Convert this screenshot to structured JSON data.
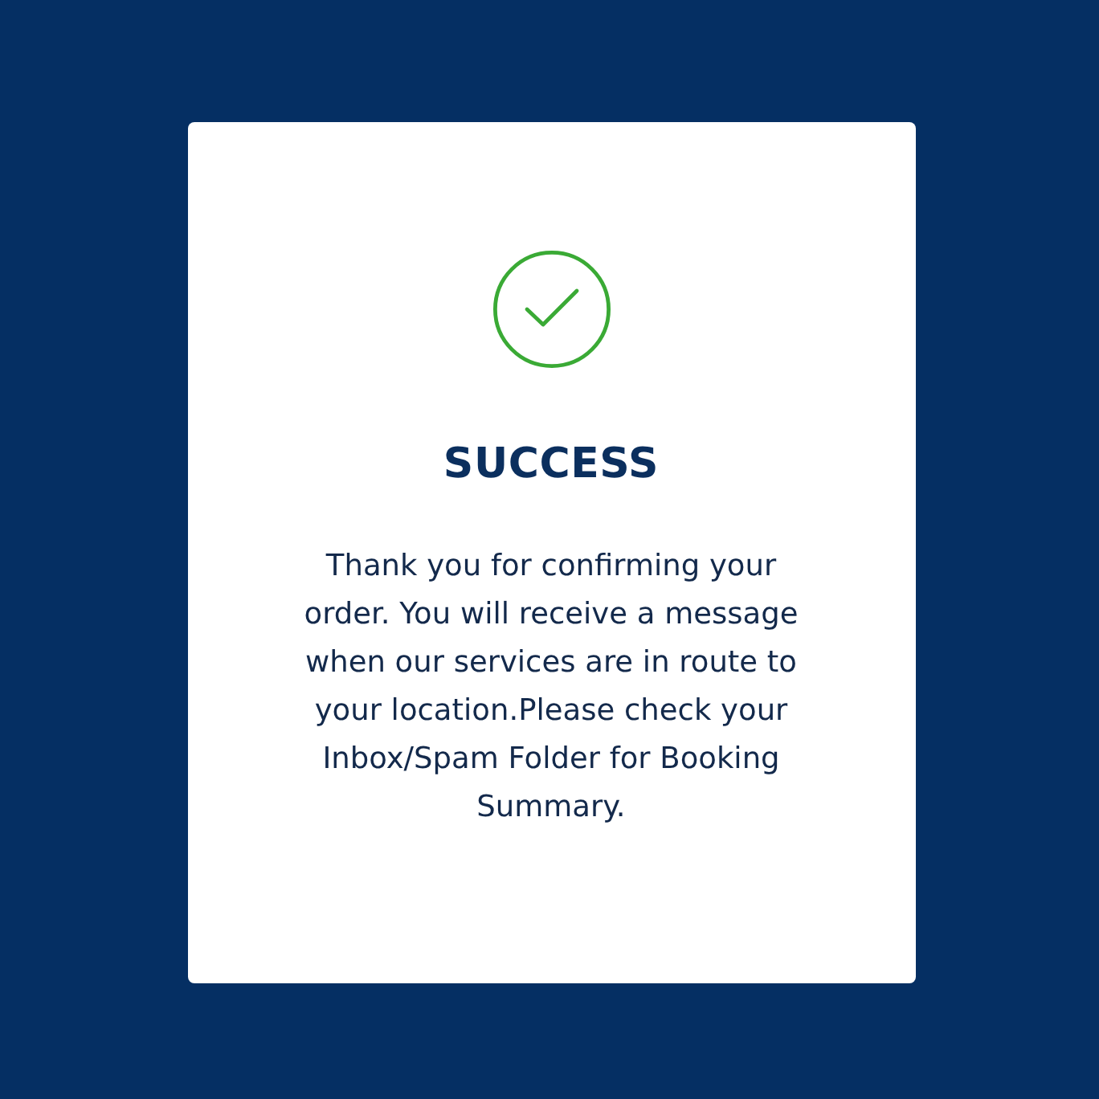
{
  "dialog": {
    "title": "SUCCESS",
    "message": "Thank you for confirming your order. You will receive a message when our services are in route to your location.Please check your Inbox/Spam Folder for Booking Summary."
  }
}
